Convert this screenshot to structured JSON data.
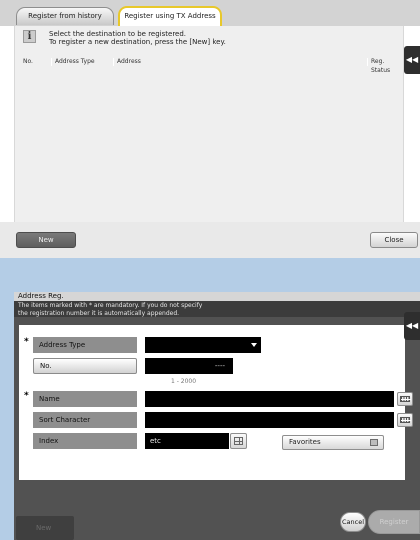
{
  "top": {
    "tabs": [
      "Register from history",
      "Register using TX Address"
    ],
    "info_line1": "Select the destination to be registered.",
    "info_line2": "To register a new destination, press the [New] key.",
    "columns": {
      "no": "No.",
      "address_type": "Address Type",
      "address": "Address",
      "reg_status": "Reg. Status"
    },
    "new_label": "New",
    "close_label": "Close",
    "back_icon": "back-arrow-icon"
  },
  "dialog": {
    "title": "Address Reg.",
    "subtitle_line1": "The items marked with * are mandatory. If you do not specify",
    "subtitle_line2": "the registration number it is automatically appended.",
    "required_mark": "*",
    "fields": {
      "address_type": {
        "label": "Address Type",
        "value": ""
      },
      "no": {
        "label": "No.",
        "value": "----",
        "range": "1 - 2000"
      },
      "name": {
        "label": "Name",
        "value": ""
      },
      "sort_character": {
        "label": "Sort Character",
        "value": ""
      },
      "index": {
        "label": "Index",
        "value": "etc"
      }
    },
    "favorites_label": "Favorites",
    "favorites_checked": false,
    "new_label": "New",
    "cancel_label": "Cancel",
    "register_label": "Register"
  },
  "colors": {
    "active_tab_border": "#e8c82a",
    "background": "#b4cde6",
    "dialog_bg": "#525252"
  }
}
